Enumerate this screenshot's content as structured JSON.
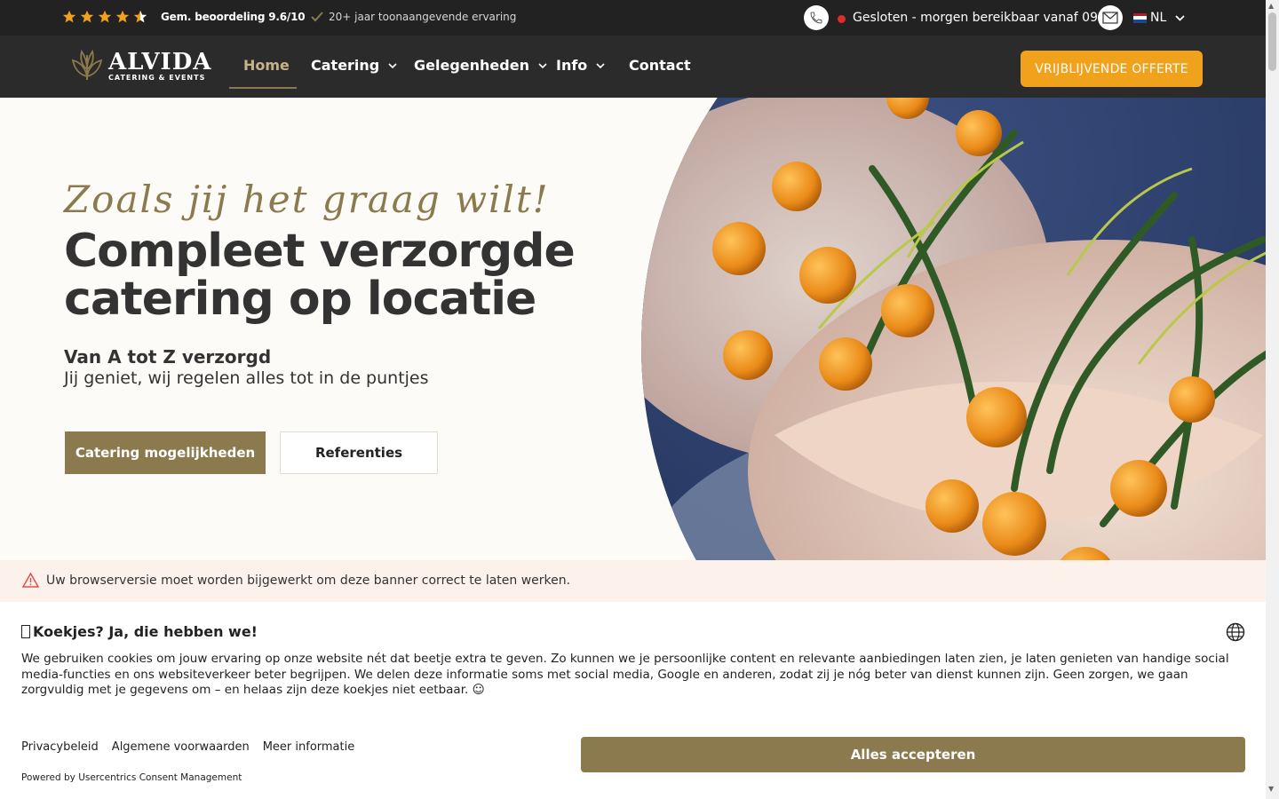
{
  "topbar": {
    "rating_stars": 4.5,
    "rating_label": "Gem. beoordeling 9.6/10",
    "experience": "20+ jaar toonaangevende ervaring",
    "status": "Gesloten - morgen bereikbaar vanaf 09:00",
    "status_color": "#e02b2b",
    "language": "NL",
    "icons": [
      "phone-icon",
      "mail-icon",
      "check-icon",
      "star-icon",
      "flag-nl-icon"
    ]
  },
  "nav": {
    "logo_name": "ALVIDA",
    "logo_sub": "CATERING & EVENTS",
    "items": [
      {
        "label": "Home",
        "active": true
      },
      {
        "label": "Catering"
      },
      {
        "label": "Gelegenheden"
      },
      {
        "label": "Info"
      },
      {
        "label": "Contact"
      }
    ],
    "cta": "VRIJBLIJVENDE OFFERTE"
  },
  "hero": {
    "script": "Zoals jij het graag wilt!",
    "title_line1": "Compleet verzorgde",
    "title_line2": "catering op locatie",
    "subtitle_strong": "Van A tot Z verzorgd",
    "subtitle": "Jij geniet, wij regelen alles tot in de puntjes",
    "btn_primary": "Catering mogelijkheden",
    "btn_secondary": "Referenties"
  },
  "warning": {
    "text": "Uw browserversie moet worden bijgewerkt om deze banner correct te laten werken."
  },
  "cookie": {
    "title": "Koekjes? Ja, die hebben we!",
    "body": "We gebruiken cookies om jouw ervaring op onze website nét dat beetje extra te geven. Zo kunnen we je persoonlijke content en relevante aanbiedingen laten zien, je laten genieten van handige social media-functies en ons websiteverkeer beter begrijpen. We delen deze informatie soms met social media, Google en anderen, zodat zij je nóg beter van dienst kunnen zijn. Geen zorgen, we gaan zorgvuldig met je gegevens om – en helaas zijn deze koekjes niet eetbaar. ☺",
    "links": [
      "Privacybeleid",
      "Algemene voorwaarden",
      "Meer informatie"
    ],
    "powered": "Powered by Usercentrics Consent Management",
    "accept": "Alles accepteren"
  },
  "colors": {
    "brand_gold": "#8c7a4f",
    "cta_orange": "#f0a21c",
    "topbar_bg": "#222222",
    "nav_bg": "#2b2b2b",
    "hero_bg": "#fdfbf7"
  }
}
